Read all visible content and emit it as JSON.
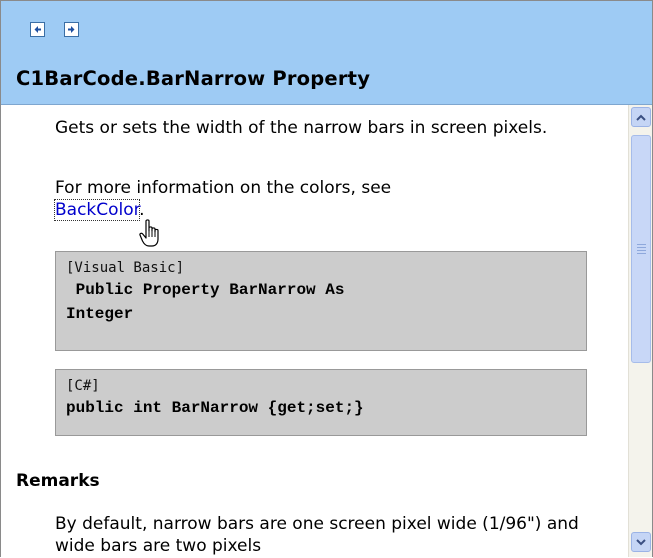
{
  "header": {
    "back_icon": "arrow-left-icon",
    "forward_icon": "arrow-right-icon",
    "title": "C1BarCode.BarNarrow Property"
  },
  "content": {
    "description": "Gets or sets the width of the narrow bars in screen pixels.",
    "more_info_prefix": "For more information on the colors, see ",
    "more_info_link": "BackColor",
    "more_info_suffix": ".",
    "code_blocks": [
      {
        "language": "[Visual Basic]",
        "code": " Public Property BarNarrow As\nInteger"
      },
      {
        "language": "[C#]",
        "code": "public int BarNarrow {get;set;}"
      }
    ],
    "remarks_heading": "Remarks",
    "remarks_text": "By default, narrow bars are one screen pixel wide (1/96\") and wide bars are two pixels"
  },
  "scrollbar": {
    "up_icon": "chevron-up-icon",
    "down_icon": "chevron-down-icon"
  },
  "colors": {
    "header_bg": "#9ecbf4",
    "code_bg": "#cccccc",
    "link": "#0000cc"
  }
}
